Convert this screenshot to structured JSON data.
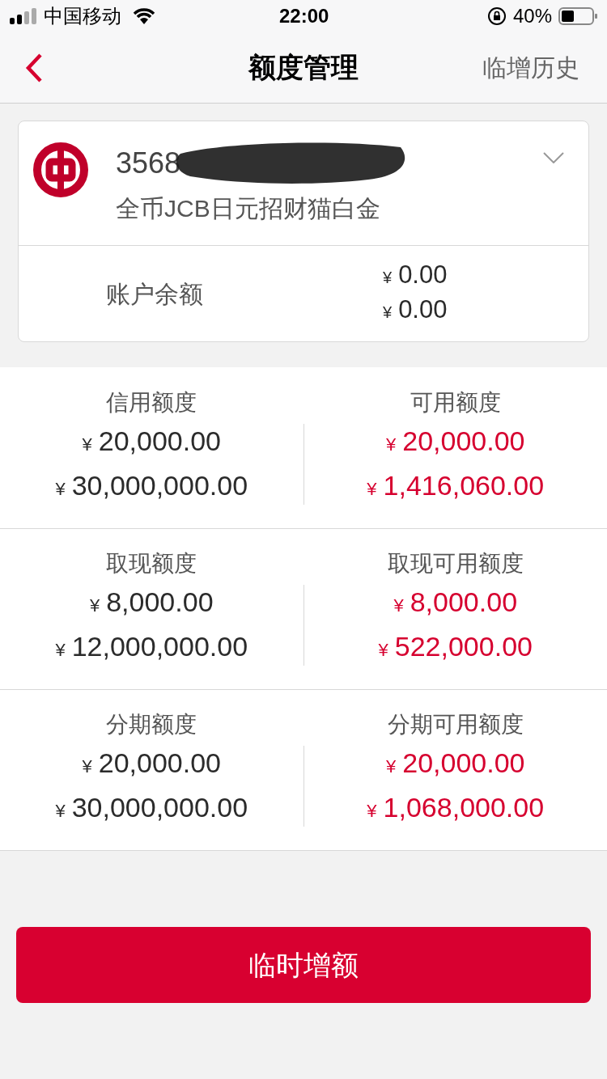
{
  "status_bar": {
    "carrier": "中国移动",
    "time": "22:00",
    "battery": "40%"
  },
  "nav": {
    "title": "额度管理",
    "action": "临增历史"
  },
  "card": {
    "number": "3568",
    "name": "全币JCB日元招财猫白金",
    "balance_label": "账户余额",
    "balances": [
      "¥ 0.00",
      "¥ 0.00"
    ]
  },
  "limits": [
    {
      "left": {
        "label": "信用额度",
        "values": [
          "¥ 20,000.00",
          "¥ 30,000,000.00"
        ]
      },
      "right": {
        "label": "可用额度",
        "values": [
          "¥ 20,000.00",
          "¥ 1,416,060.00"
        ]
      }
    },
    {
      "left": {
        "label": "取现额度",
        "values": [
          "¥ 8,000.00",
          "¥ 12,000,000.00"
        ]
      },
      "right": {
        "label": "取现可用额度",
        "values": [
          "¥ 8,000.00",
          "¥ 522,000.00"
        ]
      }
    },
    {
      "left": {
        "label": "分期额度",
        "values": [
          "¥ 20,000.00",
          "¥ 30,000,000.00"
        ]
      },
      "right": {
        "label": "分期可用额度",
        "values": [
          "¥ 20,000.00",
          "¥ 1,068,000.00"
        ]
      }
    }
  ],
  "button": "临时增额"
}
